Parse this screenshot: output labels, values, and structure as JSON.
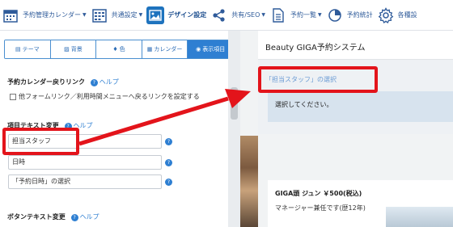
{
  "toolbar": {
    "items": [
      {
        "label": "予約管理カレンダー",
        "icon": "calendar-icon"
      },
      {
        "label": "共通設定",
        "icon": "calendar-grid-icon"
      },
      {
        "label": "デザイン設定",
        "icon": "image-icon",
        "active": true
      },
      {
        "label": "共有/SEO",
        "icon": "share-icon"
      },
      {
        "label": "予約一覧",
        "icon": "document-icon"
      },
      {
        "label": "予約統計",
        "icon": "pie-chart-icon"
      },
      {
        "label": "各種設",
        "icon": "gear-icon"
      }
    ]
  },
  "tabs": [
    {
      "label": "テーマ",
      "icon": "theme-icon"
    },
    {
      "label": "背景",
      "icon": "image-icon"
    },
    {
      "label": "色",
      "icon": "drop-icon"
    },
    {
      "label": "カレンダー",
      "icon": "calendar-icon"
    },
    {
      "label": "表示項目",
      "icon": "eye-icon",
      "active": true
    }
  ],
  "sections": {
    "return_link_title": "予約カレンダー戻りリンク",
    "help_label": "ヘルプ",
    "return_link_checkbox": "他フォームリンク／利用時間メニューへ戻るリンクを設定する",
    "item_text_title": "項目テキスト変更",
    "button_text_title": "ボタンテキスト変更"
  },
  "fields": {
    "staff": "担当スタッフ",
    "datetime": "日時",
    "datetime_select": "「予約日時」の選択"
  },
  "preview": {
    "app_title": "Beauty GIGA予約システム",
    "staff_select_link": "「担当スタッフ」の選択",
    "message": "選択してください。",
    "staff_name": "GIGA頭 ジュン ￥500(税込)",
    "staff_desc": "マネージャー兼任です(歴12年)"
  },
  "colors": {
    "accent": "#2e7fd2",
    "highlight": "#e3141b"
  }
}
